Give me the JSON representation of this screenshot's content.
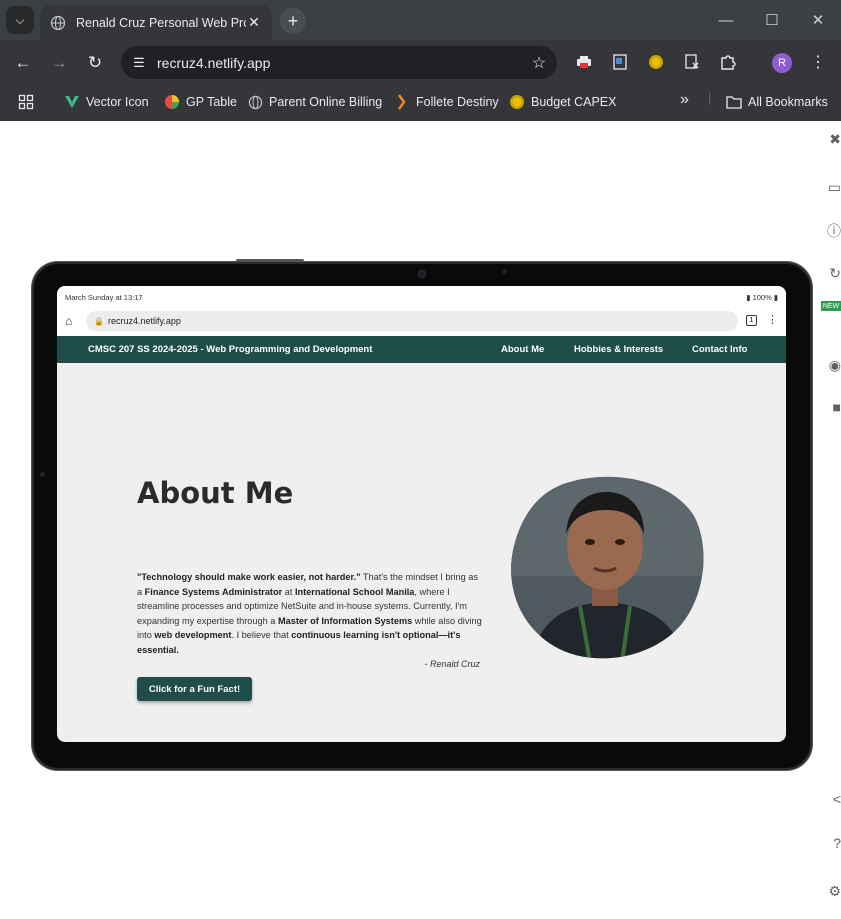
{
  "browser": {
    "tab_title": "Renald Cruz Personal Web Profi",
    "url": "recruz4.netlify.app",
    "profile_initial": "R",
    "bookmarks": [
      {
        "label": "Vector Icon"
      },
      {
        "label": "GP Table"
      },
      {
        "label": "Parent Online Billing"
      },
      {
        "label": "Follete Destiny"
      },
      {
        "label": "Budget CAPEX"
      }
    ],
    "all_bookmarks": "All Bookmarks",
    "more_bookmarks": "»"
  },
  "tablet": {
    "status_time": "March Sunday at 13:17",
    "status_battery": "100%",
    "url": "recruz4.netlify.app",
    "tab_count": "1"
  },
  "site": {
    "nav_brand": "CMSC 207 SS 2024-2025 - Web Programming and Development",
    "nav_links": [
      "About Me",
      "Hobbies & Interests",
      "Contact Info"
    ],
    "heading": "About Me",
    "paragraph": {
      "q1": "\"Technology should make work easier, not harder.\"",
      "t1": " That's the mindset I bring as a ",
      "b1": "Finance Systems Administrator",
      "t2": " at ",
      "b2": "International School Manila",
      "t3": ", where I streamline processes and optimize NetSuite and in-house systems. Currently, I'm expanding my expertise through a ",
      "b3": "Master of Information Systems",
      "t4": " while also diving into ",
      "b4": "web development",
      "t5": ". I believe that ",
      "b5": "continuous learning isn't optional—it's essential."
    },
    "signature": "- Renald Cruz",
    "button_label": "Click for a Fun Fact!"
  },
  "colors": {
    "site_nav": "#1e4d4a",
    "chrome_dark": "#35363a"
  }
}
